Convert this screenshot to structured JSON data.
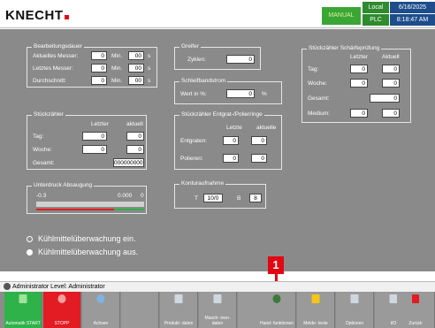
{
  "header": {
    "logo": "KNECHT",
    "mode": "MANUAL",
    "local": "Local",
    "plc": "PLC",
    "date": "6/16/2025",
    "time": "8:18:47 AM"
  },
  "bearbeitungsdauer": {
    "title": "Bearbeitungsdauer",
    "rows": [
      {
        "label": "Aktuelles Messer:",
        "min": "0",
        "min_unit": "Min.",
        "sec": "00",
        "sec_unit": "s"
      },
      {
        "label": "Letztes Messer:",
        "min": "0",
        "min_unit": "Min.",
        "sec": "00",
        "sec_unit": "s"
      },
      {
        "label": "Durchschnitt:",
        "min": "0",
        "min_unit": "Min.",
        "sec": "00",
        "sec_unit": "s"
      }
    ]
  },
  "stueckzaehler": {
    "title": "Stückzähler",
    "col_last": "Letzter",
    "col_current": "aktuell",
    "rows": [
      {
        "label": "Tag:",
        "last": "0",
        "current": "0"
      },
      {
        "label": "Woche:",
        "last": "0",
        "current": "0"
      }
    ],
    "total_label": "Gesamt:",
    "total": "000000000"
  },
  "unterdruck": {
    "title": "Unterdruck Absaugung",
    "min": "-0.3",
    "value": "0.000",
    "max": "0"
  },
  "greifer": {
    "title": "Greifer",
    "label": "Zyklen:",
    "value": "0"
  },
  "schleifbandstrom": {
    "title": "Schleifbandstrom",
    "label": "Wert in %:",
    "value": "0",
    "unit": "%"
  },
  "entgrat": {
    "title": "Stückzähler Entgrat-/Polierringe",
    "col_last": "Letzte",
    "col_current": "aktuelle",
    "rows": [
      {
        "label": "Entgraten:",
        "last": "0",
        "current": "0"
      },
      {
        "label": "Polieren:",
        "last": "0",
        "current": "0"
      }
    ]
  },
  "konturaufnahme": {
    "title": "Konturaufnahme",
    "t_label": "T",
    "t_value": "10/0",
    "b_label": "B",
    "b_value": "8"
  },
  "schaerfe": {
    "title": "Stückzähler Schärfeprüfung",
    "col_last": "Letzter",
    "col_current": "Aktuell",
    "rows": [
      {
        "label": "Tag:",
        "last": "0",
        "current": "0"
      },
      {
        "label": "Woche:",
        "last": "0",
        "current": "0"
      }
    ],
    "total_label": "Gesamt:",
    "total": "0",
    "medium_label": "Medium:",
    "medium_last": "0",
    "medium_current": "0"
  },
  "coolant": {
    "on_label": "Kühlmittelüberwachung ein.",
    "off_label": "Kühlmittelüberwachung aus.",
    "selected": "off"
  },
  "user": {
    "text": "Administrator  Level: Administrator"
  },
  "callout": "1",
  "buttons": [
    {
      "label": "Automatik START"
    },
    {
      "label": "STOPP"
    },
    {
      "label": "Achsen"
    },
    {
      "label": ""
    },
    {
      "label": "Produkt- daten"
    },
    {
      "label": "Masch- inen- daten"
    },
    {
      "label": ""
    },
    {
      "label": "Hand- funktionen"
    },
    {
      "label": "Melde- texte"
    },
    {
      "label": "Optionen"
    },
    {
      "label": "I/O"
    },
    {
      "label": "Zurück"
    }
  ],
  "colors": {
    "start": "#2fb24a",
    "stop": "#e31b23",
    "manual": "#3aa635",
    "accent": "#e30613"
  }
}
